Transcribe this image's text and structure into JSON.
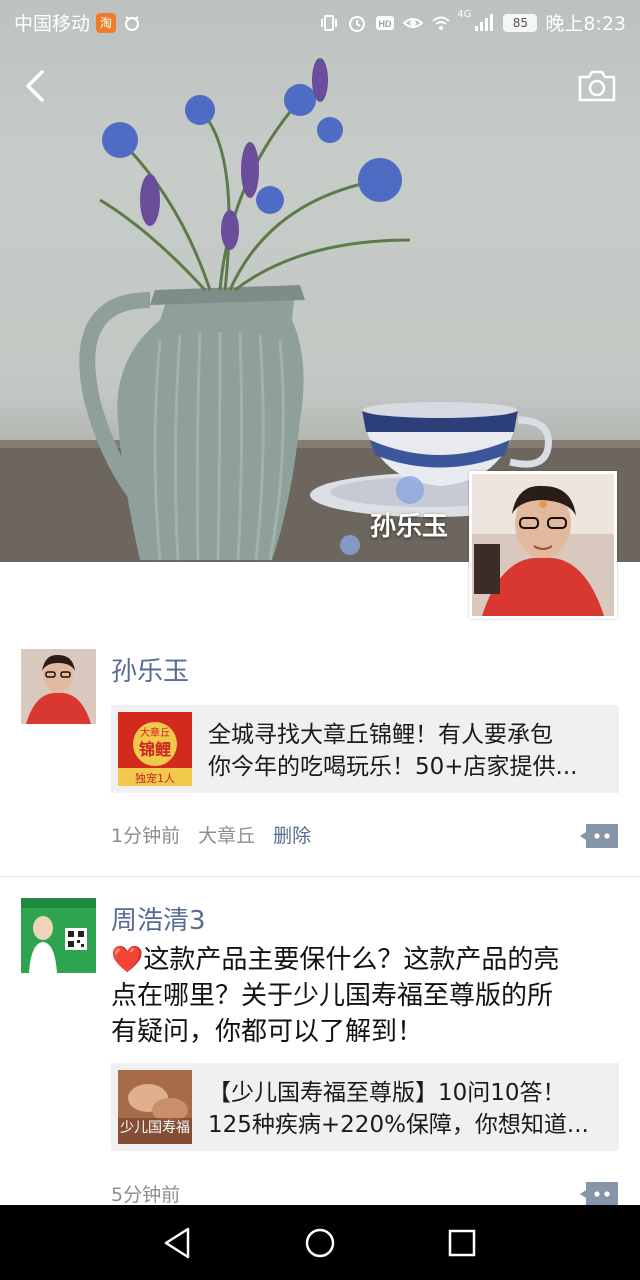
{
  "status_bar": {
    "carrier": "中国移动",
    "app_badge": "淘",
    "network": "4G",
    "battery": "85",
    "time": "晚上8:23"
  },
  "cover": {
    "name": "孙乐玉"
  },
  "posts": [
    {
      "author": "孙乐玉",
      "text": "",
      "link": {
        "thumb_text_top": "大章丘",
        "thumb_text_mid": "锦鲤",
        "thumb_text_bottom": "独宠1人",
        "title_line1": "全城寻找大章丘锦鲤！有人要承包",
        "title_line2": "你今年的吃喝玩乐！50+店家提供..."
      },
      "time": "1分钟前",
      "location": "大章丘",
      "action": "删除"
    },
    {
      "author": "周浩清3",
      "text_line1": "❤️这款产品主要保什么？这款产品的亮",
      "text_line2": "点在哪里？关于少儿国寿福至尊版的所",
      "text_line3": "有疑问，你都可以了解到！",
      "link": {
        "thumb_text": "少儿国寿福",
        "title_line1": "【少儿国寿福至尊版】10问10答！",
        "title_line2": "125种疾病+220%保障，你想知道..."
      },
      "time": "5分钟前"
    }
  ],
  "colors": {
    "link_blue": "#576b95",
    "card_bg": "#f0f0f0",
    "nav_bg": "#000000"
  }
}
